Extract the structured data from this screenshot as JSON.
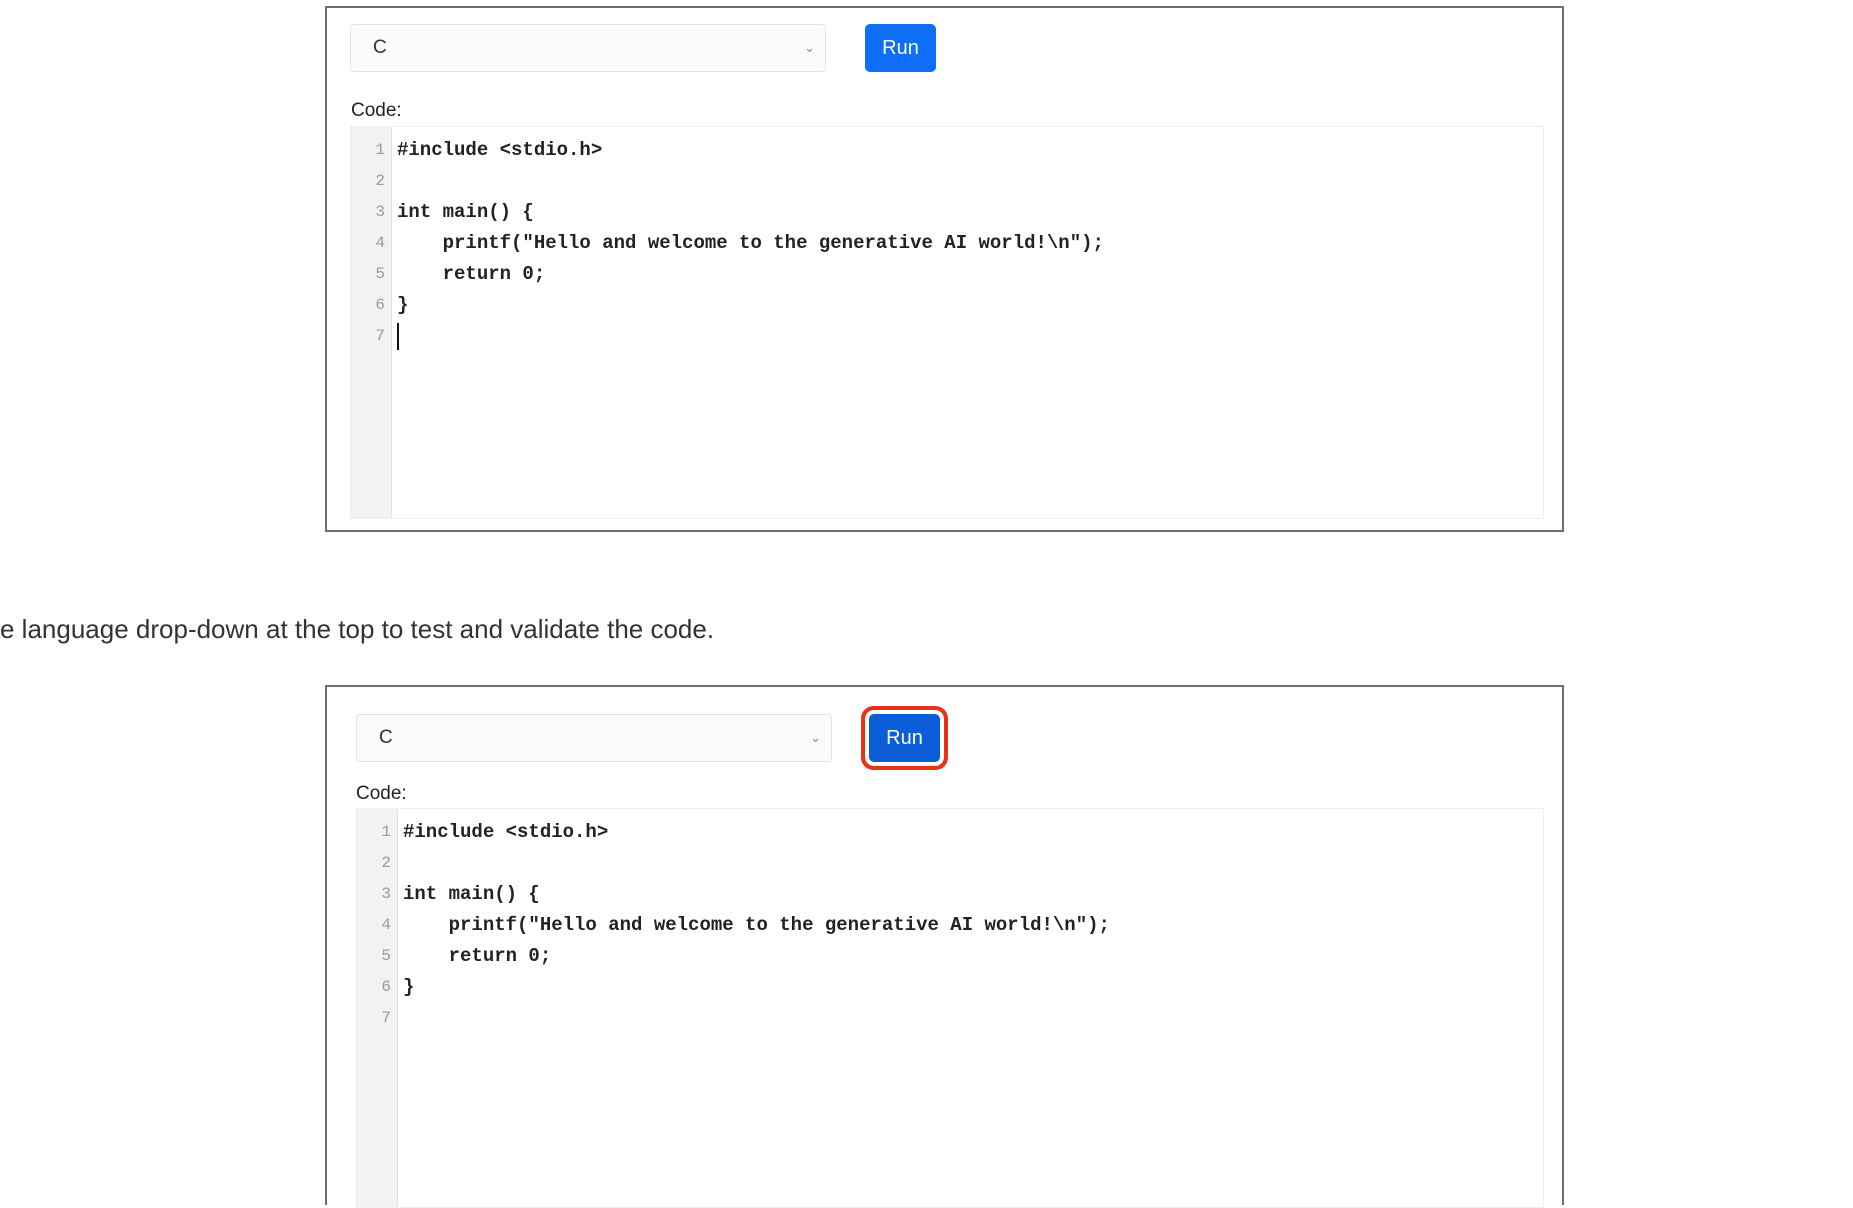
{
  "screenshot_1": {
    "language_select": {
      "value": "C",
      "chevron": "chevron-down-icon"
    },
    "run_button": {
      "label": "Run"
    },
    "code_label": "Code:",
    "code_lines": [
      {
        "n": "1",
        "text": "#include <stdio.h>"
      },
      {
        "n": "2",
        "text": ""
      },
      {
        "n": "3",
        "text": "int main() {"
      },
      {
        "n": "4",
        "text": "    printf(\"Hello and welcome to the generative AI world!\\n\");"
      },
      {
        "n": "5",
        "text": "    return 0;"
      },
      {
        "n": "6",
        "text": "}"
      },
      {
        "n": "7",
        "text": ""
      }
    ]
  },
  "instruction_text": "e language drop-down at the top to test and validate the code.",
  "screenshot_2": {
    "language_select": {
      "value": "C",
      "chevron": "chevron-down-icon"
    },
    "run_button": {
      "label": "Run",
      "highlight_color": "#e8311a"
    },
    "code_label": "Code:",
    "code_lines": [
      {
        "n": "1",
        "text": "#include <stdio.h>"
      },
      {
        "n": "2",
        "text": ""
      },
      {
        "n": "3",
        "text": "int main() {"
      },
      {
        "n": "4",
        "text": "    printf(\"Hello and welcome to the generative AI world!\\n\");"
      },
      {
        "n": "5",
        "text": "    return 0;"
      },
      {
        "n": "6",
        "text": "}"
      },
      {
        "n": "7",
        "text": ""
      }
    ]
  },
  "colors": {
    "run_button": "#0d6ff7",
    "highlight_ring": "#e8311a",
    "frame_border": "#6f6f6f"
  }
}
